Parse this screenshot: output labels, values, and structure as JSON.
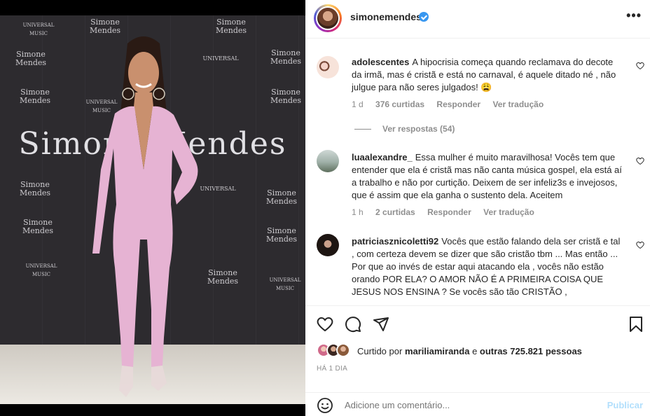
{
  "post": {
    "username": "simonemendes",
    "more_icon": "more-horizontal-icon"
  },
  "photo": {
    "backdrop_texts": [
      "UNIVERSAL MUSIC",
      "Simone Mendes",
      "UNIVERSAL",
      "UNIVERSAL MUSIC",
      "Simone Mendes",
      "Simone Mendes",
      "Simone Mendes",
      "Simone Mendes",
      "UNIVERSAL MUSIC",
      "Simone Mendes",
      "Simone Mendes",
      "Simone Mendes",
      "UNIVERSAL",
      "Simone Mendes",
      "Simone Mendes",
      "UNIVERSAL MUSIC",
      "Simone Mendes"
    ],
    "big_name": "Simone Mendes",
    "outfit_color": "#e6b3d3"
  },
  "comments": [
    {
      "user": "adolescentes",
      "text": "A hipocrisia começa quando reclamava do decote da irmã, mas é cristã e está no carnaval, é aquele ditado né , não julgue para não seres julgados! 😩",
      "time": "1 d",
      "likes": "376 curtidas",
      "reply": "Responder",
      "translate": "Ver tradução",
      "replies": "Ver respostas (54)"
    },
    {
      "user": "luaalexandre_",
      "text": "Essa mulher é muito maravilhosa! Vocês tem que entender que ela é cristã mas não canta música gospel, ela está aí a trabalho e não por curtição. Deixem de ser infeliz3s e invejosos, que é assim que ela ganha o sustento dela. Aceitem",
      "time": "1 h",
      "likes": "2 curtidas",
      "reply": "Responder",
      "translate": "Ver tradução"
    },
    {
      "user": "patriciasznicoletti92",
      "text": "Vocês que estão falando dela ser cristã e tal , com certeza devem se dizer que são cristão tbm ... Mas então ... Por que ao invés de estar aqui atacando ela , vocês não estão orando POR ELA? O AMOR NÃO É A PRIMEIRA COISA QUE JESUS NOS ENSINA ? Se vocês são tão CRISTÃO ,"
    }
  ],
  "actions": {
    "like_icon": "heart-icon",
    "comment_icon": "comment-icon",
    "share_icon": "send-icon",
    "save_icon": "bookmark-icon"
  },
  "likes": {
    "prefix": "Curtido por",
    "user": "mariliamiranda",
    "middle": "e",
    "count": "outras 725.821 pessoas"
  },
  "timestamp": "HÁ 1 DIA",
  "add_comment": {
    "placeholder": "Adicione um comentário...",
    "publish": "Publicar",
    "emoji_icon": "emoji-icon"
  },
  "colors": {
    "verified": "#3897f0",
    "publish_disabled": "#b2dffc",
    "muted": "#8e8e8e"
  }
}
